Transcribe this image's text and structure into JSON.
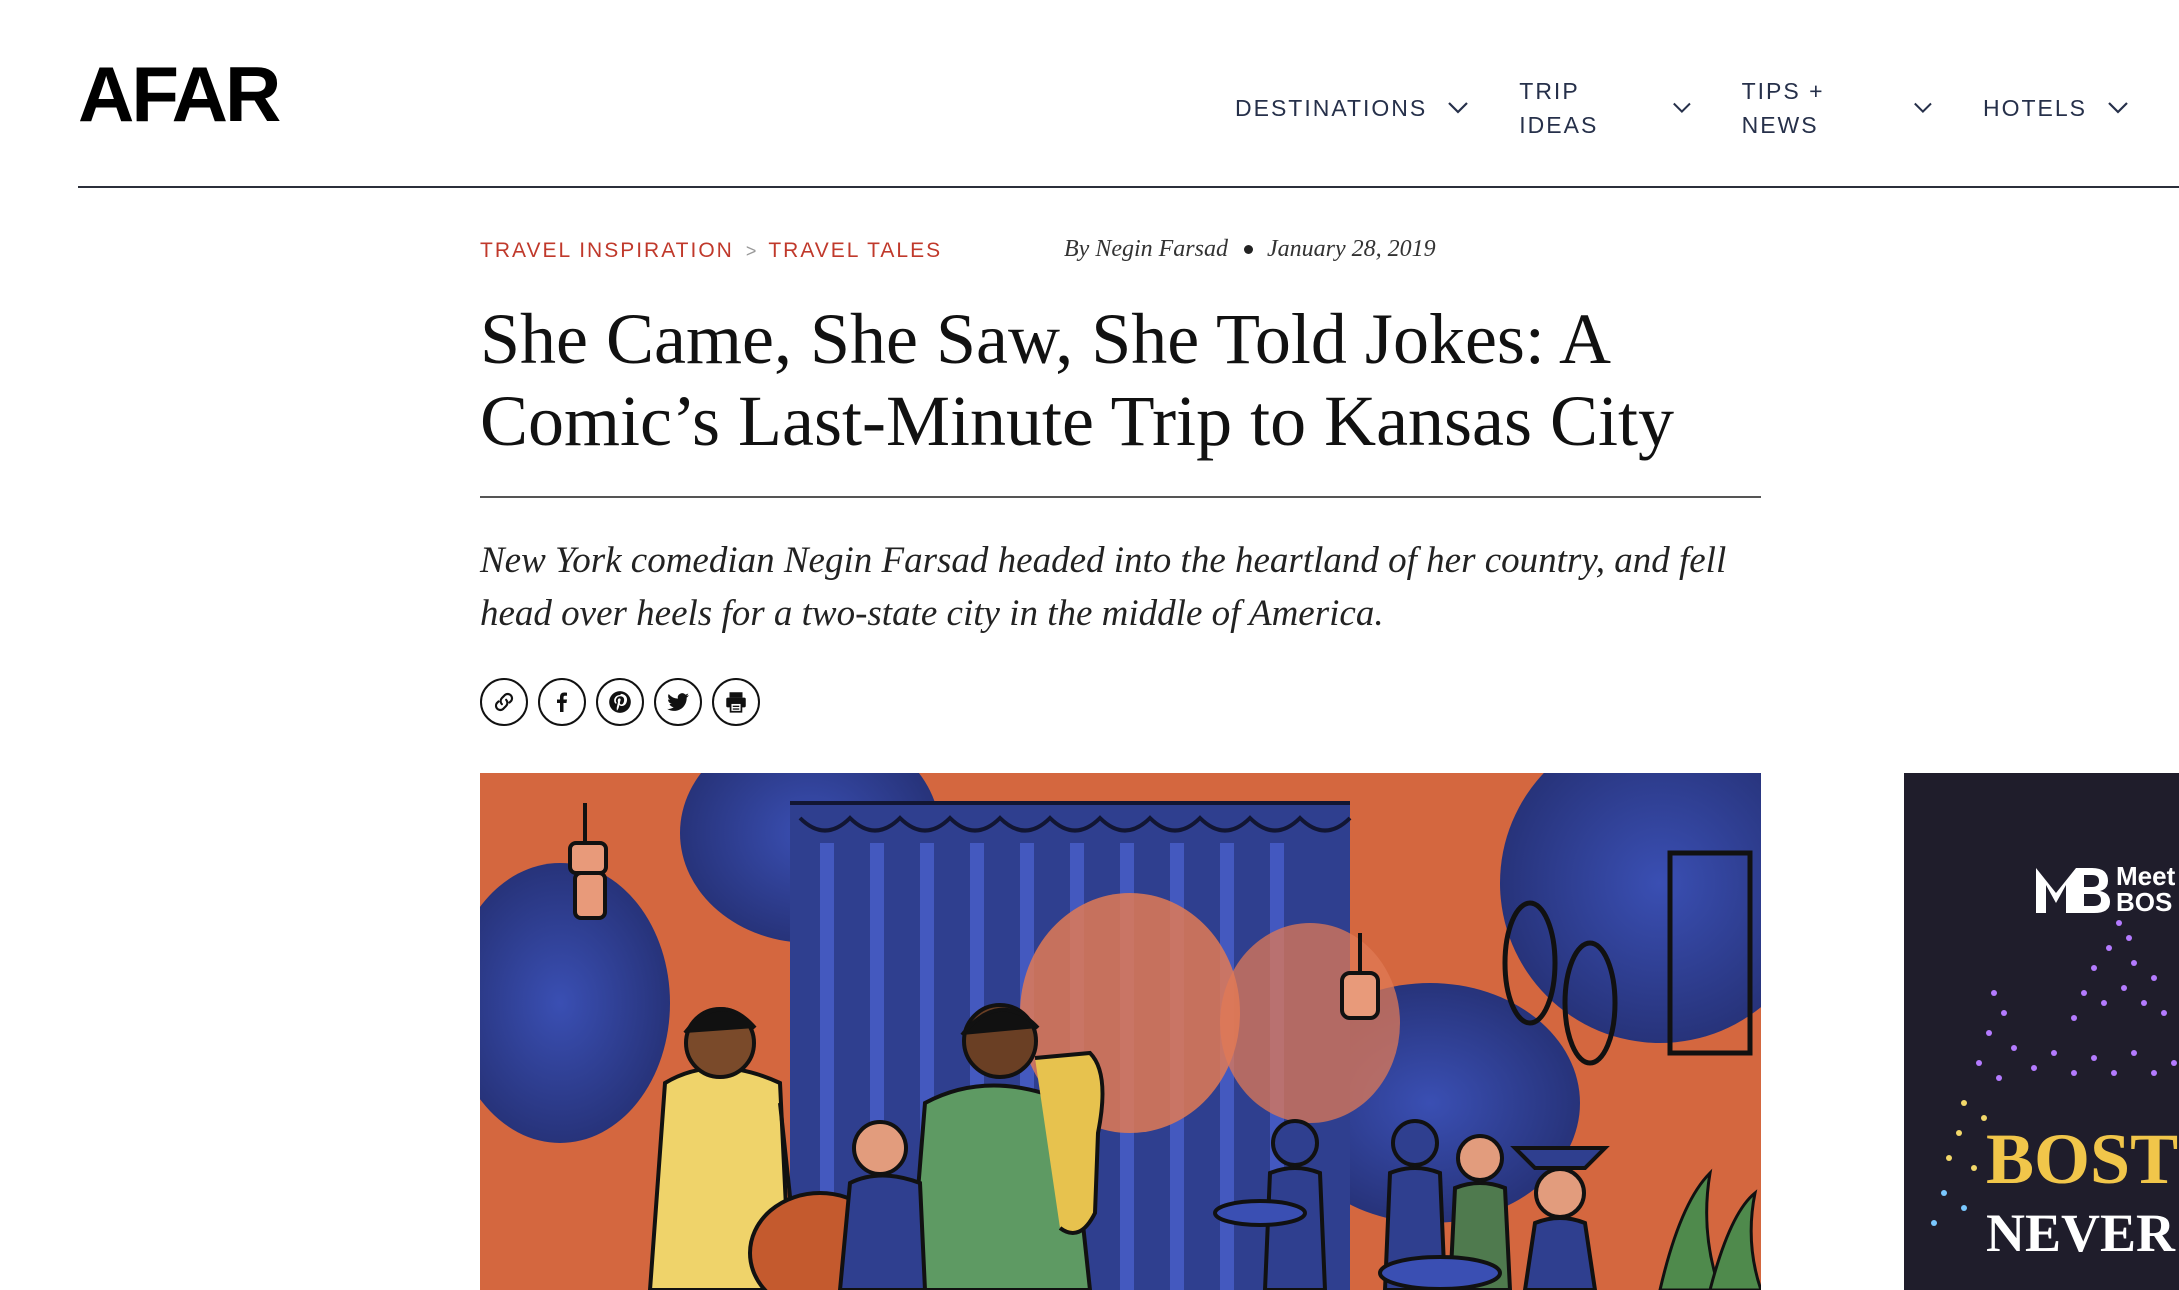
{
  "header": {
    "logo": "AFAR",
    "nav": [
      {
        "label": "DESTINATIONS"
      },
      {
        "label": "TRIP IDEAS"
      },
      {
        "label": "TIPS + NEWS"
      },
      {
        "label": "HOTELS"
      }
    ]
  },
  "article": {
    "breadcrumb": [
      "TRAVEL INSPIRATION",
      "TRAVEL TALES"
    ],
    "breadcrumb_sep": ">",
    "author": "By Negin Farsad",
    "date": "January 28, 2019",
    "title": "She Came, She Saw, She Told Jokes: A Comic’s Last-Minute Trip to Kansas City",
    "dek": "New York comedian Negin Farsad headed into the heartland of her country, and fell head over heels for a two-state city in the middle of America.",
    "share_icons": [
      "link-icon",
      "facebook-icon",
      "pinterest-icon",
      "twitter-icon",
      "print-icon"
    ]
  },
  "ad": {
    "logo_text": "Meet",
    "logo_text2": "BOS",
    "headline": "BOST",
    "subline": "NEVER"
  },
  "colors": {
    "accent": "#c0392b",
    "nav": "#26304a",
    "hero_orange": "#d4673f",
    "hero_blue": "#2f3f8f"
  }
}
